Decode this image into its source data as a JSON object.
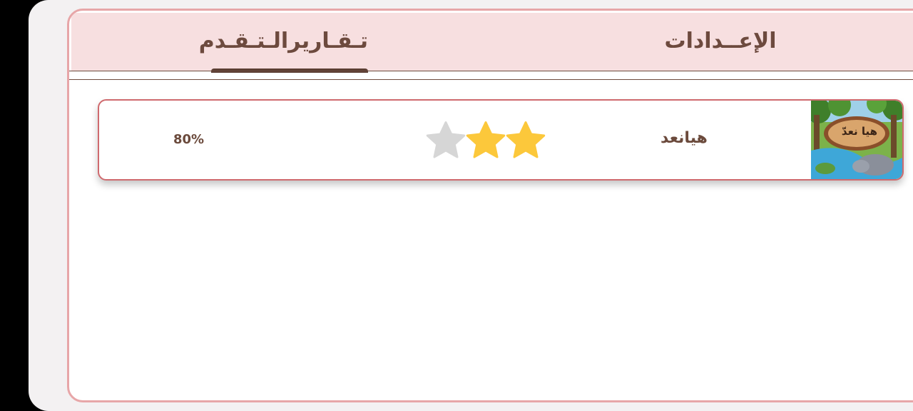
{
  "tabs": {
    "reports_label": "تـقـاريرالـتـقـدم",
    "settings_label": "الإعــدادات"
  },
  "progress_rows": [
    {
      "percent_text": "80%",
      "stars_filled": 2,
      "stars_total": 3,
      "game_name": "هيانعد",
      "thumbnail_sign_text": "هيا نعدّ"
    }
  ],
  "colors": {
    "star_filled": "#fcc83b",
    "star_empty": "#d6d6d6",
    "accent_border": "#cf6a6e",
    "text_brown": "#6b4a3c",
    "tab_bg": "#f7dfe0"
  }
}
